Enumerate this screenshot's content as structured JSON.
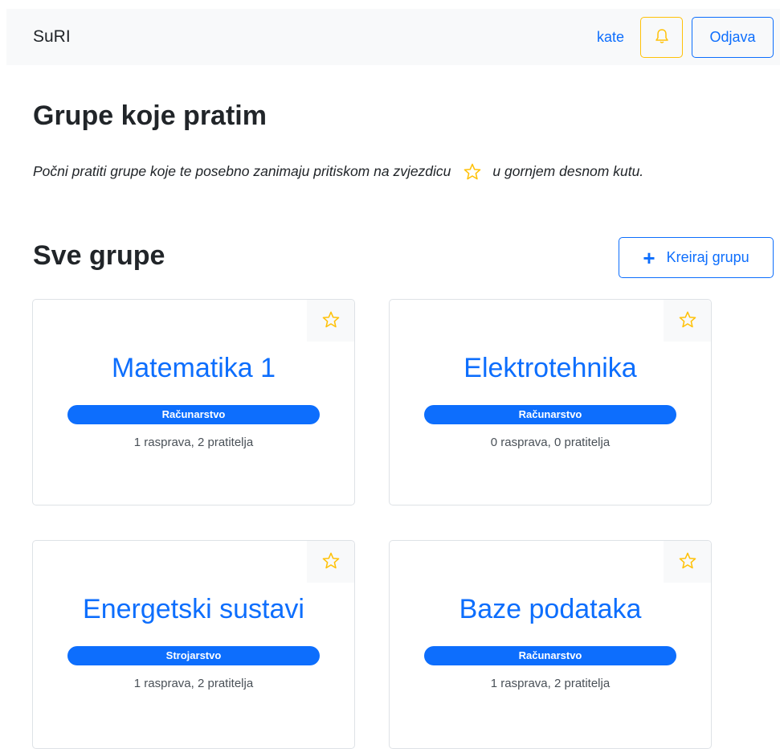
{
  "navbar": {
    "brand": "SuRI",
    "username": "kate",
    "logout_label": "Odjava",
    "bell_icon": "bell-icon"
  },
  "followed": {
    "heading": "Grupe koje pratim",
    "hint_before": "Počni pratiti grupe koje te posebno zanimaju pritiskom na zvjezdicu",
    "hint_after": "u gornjem desnom kutu."
  },
  "all_groups": {
    "heading": "Sve grupe",
    "create_label": "Kreiraj grupu",
    "cards": [
      {
        "title": "Matematika 1",
        "category": "Računarstvo",
        "stats": "1 rasprava, 2 pratitelja"
      },
      {
        "title": "Elektrotehnika",
        "category": "Računarstvo",
        "stats": "0 rasprava, 0 pratitelja"
      },
      {
        "title": "Energetski sustavi",
        "category": "Strojarstvo",
        "stats": "1 rasprava, 2 pratitelja"
      },
      {
        "title": "Baze podataka",
        "category": "Računarstvo",
        "stats": "1 rasprava, 2 pratitelja"
      }
    ]
  },
  "colors": {
    "primary": "#0d6efd",
    "warning": "#ffc107",
    "navbar_bg": "#f8f9fa"
  }
}
